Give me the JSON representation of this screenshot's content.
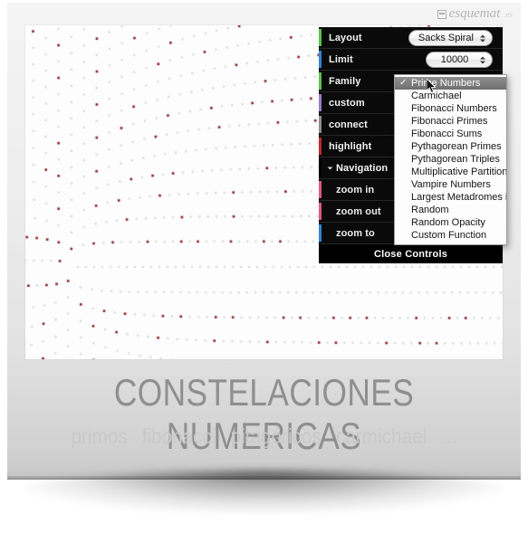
{
  "brand": {
    "icon": "window-grid-icon",
    "name": "esquemat",
    "tld": ".es"
  },
  "panel": {
    "rows": [
      {
        "label": "Layout",
        "accent": "#5cc24a",
        "control": "select",
        "value": "Sacks Spiral",
        "kind": "top"
      },
      {
        "label": "Limit",
        "accent": "#2f86d8",
        "control": "select",
        "value": "10000",
        "kind": "top"
      },
      {
        "label": "Family",
        "accent": "#5cc24a",
        "control": "select",
        "value": "Prime Numbers",
        "kind": "top"
      },
      {
        "label": "custom",
        "accent": "#9a7ec4",
        "control": "none",
        "value": "",
        "kind": "top"
      },
      {
        "label": "connect",
        "accent": "#8f8f8f",
        "control": "none",
        "value": "",
        "kind": "top"
      },
      {
        "label": "highlight",
        "accent": "#c0282d",
        "control": "none",
        "value": "",
        "kind": "top"
      },
      {
        "label": "Navigation",
        "accent": "#000000",
        "control": "none",
        "value": "",
        "kind": "group"
      },
      {
        "label": "zoom in",
        "accent": "#e05a7a",
        "control": "none",
        "value": "",
        "kind": "sub"
      },
      {
        "label": "zoom out",
        "accent": "#e05a7a",
        "control": "none",
        "value": "",
        "kind": "sub"
      },
      {
        "label": "zoom to",
        "accent": "#2f86d8",
        "control": "none",
        "value": "",
        "kind": "sub"
      }
    ],
    "footer_label": "Close Controls"
  },
  "family_menu": {
    "selected": "Prime Numbers",
    "check_glyph": "✓",
    "items": [
      "Prime Numbers",
      "Carmichael",
      "Fibonacci Numbers",
      "Fibonacci Primes",
      "Fibonacci Sums",
      "Pythagorean Primes",
      "Pythagorean Triples",
      "Multiplicative Partitions",
      "Vampire Numbers",
      "Largest Metadromes in Base",
      "Random",
      "Random Opacity",
      "Custom Function"
    ]
  },
  "visualization": {
    "layout": "Sacks Spiral",
    "limit": "10000",
    "family": "Prime Numbers",
    "dot_color_normal": "#d6dade",
    "dot_color_highlight": "#8c1f26",
    "background": "#fdfdfd"
  },
  "caption": {
    "title": "CONSTELACIONES NUMERICAS",
    "tags": [
      "primos",
      "fibonacci",
      "pitagóricos",
      "carmichael",
      "..."
    ]
  }
}
